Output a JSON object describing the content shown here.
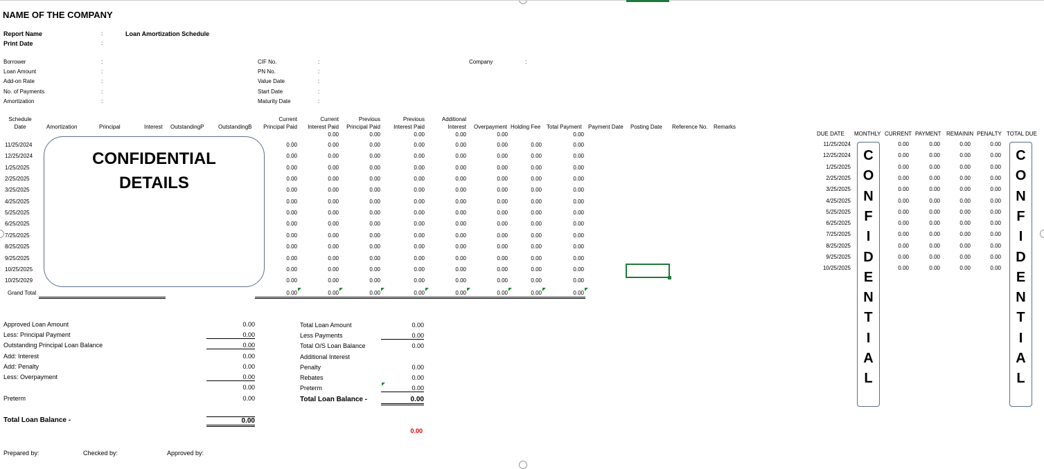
{
  "company_name": "NAME OF THE COMPANY",
  "report": {
    "name_label": "Report Name",
    "name_value": "Loan Amortization Schedule",
    "print_date_label": "Print Date",
    "colon": ":"
  },
  "info": {
    "left": [
      "Borrower",
      "Loan Amount",
      "Add-on Rate",
      "No. of Payments",
      "Amortization"
    ],
    "mid": [
      "CIF No.",
      "PN No.",
      "Value Date",
      "Start Date",
      "Maturity Date"
    ],
    "company_label": "Company"
  },
  "schedule": {
    "headers": {
      "date": [
        "Schedule",
        "Date"
      ],
      "amortization": "Amortization",
      "principal": "Principal",
      "interest": "Interest",
      "outstanding_p": "OutstandingP",
      "outstanding_b": "OutstandingB",
      "cur_principal": [
        "Current",
        "Principal Paid"
      ],
      "cur_interest": [
        "Current",
        "Interest Paid"
      ],
      "prev_principal": [
        "Previous",
        "Principal Paid"
      ],
      "prev_interest": [
        "Previous",
        "Interest Paid"
      ],
      "additional_interest": [
        "Additional",
        "Interest"
      ],
      "overpayment": "Overpayment",
      "holding_fee": "Holding Fee",
      "total_payment": "Total Payment",
      "payment_date": "Payment Date",
      "posting_date": "Posting Date",
      "reference_no": "Reference No.",
      "remarks": "Remarks"
    },
    "subheader_values": [
      "0.00",
      "0.00",
      "0.00",
      "0.00",
      "0.00",
      "0.00"
    ],
    "dates": [
      "11/25/2024",
      "12/25/2024",
      "1/25/2025",
      "2/25/2025",
      "3/25/2025",
      "4/25/2025",
      "5/25/2025",
      "6/25/2025",
      "7/25/2025",
      "8/25/2025",
      "9/25/2025",
      "10/25/2025",
      "10/25/2029"
    ],
    "zero": "0.00",
    "grand_total_label": "Grand Total",
    "grand_total_values": [
      "0.00",
      "0.00",
      "0.00",
      "0.00",
      "0.00",
      "0.00",
      "0.00",
      "0.00"
    ]
  },
  "confidential_box": {
    "line1": "CONFIDENTIAL",
    "line2": "DETAILS"
  },
  "summary_left": {
    "rows": [
      {
        "label": "Approved Loan Amount",
        "value": "0.00"
      },
      {
        "label": "Less: Principal Payment",
        "value": "0.00"
      },
      {
        "label": "Outstanding Principal Loan Balance",
        "value": "0.00"
      },
      {
        "label": "Add: Interest",
        "value": "0.00"
      },
      {
        "label": "Add: Penalty",
        "value": "0.00"
      },
      {
        "label": "Less: Overpayment",
        "value": "0.00"
      },
      {
        "label": "",
        "value": "0.00"
      },
      {
        "label": "Preterm",
        "value": "0.00"
      }
    ],
    "total_label": "Total Loan Balance -",
    "total_value": "0.00"
  },
  "summary_right": {
    "rows": [
      {
        "label": "Total Loan Amount",
        "value": "0.00"
      },
      {
        "label": "Less Payments",
        "value": "0.00"
      },
      {
        "label": "Total O/S Loan Balance",
        "value": "0.00"
      },
      {
        "label": "Additional Interest",
        "value": ""
      },
      {
        "label": "Penalty",
        "value": "0.00"
      },
      {
        "label": "Rebates",
        "value": "0.00"
      },
      {
        "label": "Preterm",
        "value": "0.00"
      }
    ],
    "total_label": "Total Loan Balance -",
    "total_value": "0.00",
    "red_value": "0.00"
  },
  "signatures": {
    "prepared": "Prepared by:",
    "checked": "Checked by:",
    "approved": "Approved by:"
  },
  "due_table": {
    "headers": [
      "DUE DATE",
      "MONTHLY",
      "CURRENT",
      "PAYMENT",
      "REMAININ",
      "PENALTY",
      "TOTAL DUE"
    ],
    "dates": [
      "11/25/2024",
      "12/25/2024",
      "1/25/2025",
      "2/25/2025",
      "3/25/2025",
      "4/25/2025",
      "5/25/2025",
      "6/25/2025",
      "7/25/2025",
      "8/25/2025",
      "9/25/2025",
      "10/25/2025"
    ],
    "zero": "0.00"
  },
  "vertical_confidential": {
    "left_letters": [
      "C",
      "O",
      "N",
      "F",
      "I",
      "D",
      "E",
      "N",
      "T",
      "I",
      "A",
      "L"
    ],
    "right_letters": [
      "C",
      "O",
      "N",
      "F",
      "I",
      "D",
      "E",
      "N",
      "T",
      "I",
      "A",
      "L"
    ]
  },
  "colors": {
    "accent_green": "#1d7a3a",
    "red_value": "#e00000",
    "box_border": "#5a6f8a"
  }
}
